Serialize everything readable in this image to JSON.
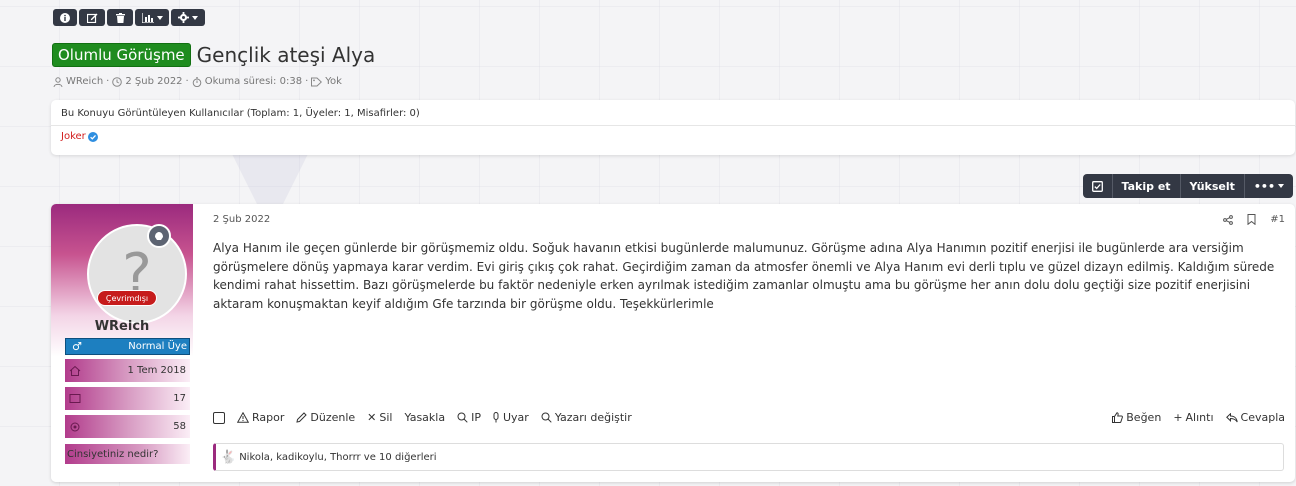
{
  "toolbar": {
    "icons": [
      "info-icon",
      "edit-icon",
      "trash-icon",
      "chart-icon",
      "gear-icon"
    ]
  },
  "thread": {
    "prefix": "Olumlu Görüşme",
    "title": "Gençlik ateşi Alya",
    "meta": {
      "author": "WReich",
      "date": "2 Şub 2022",
      "read_time": "Okuma süresi: 0:38",
      "tags": "Yok"
    }
  },
  "viewers": {
    "title": "Bu Konuyu Görüntüleyen Kullanıcılar (Toplam: 1, Üyeler: 1, Misafirler: 0)",
    "users": [
      "Joker"
    ]
  },
  "actions": {
    "follow": "Takip et",
    "bump": "Yükselt",
    "more": "•••"
  },
  "post": {
    "user": {
      "avatar_letter": "?",
      "status": "Çevrimdışı",
      "name": "WReich",
      "gender_symbol": "♂",
      "role": "Normal Üye",
      "joined": "1 Tem 2018",
      "messages": "17",
      "points": "58",
      "question": "Cinsiyetiniz nedir?"
    },
    "date": "2 Şub 2022",
    "number": "#1",
    "body": "Alya Hanım ile geçen günlerde bir görüşmemiz oldu. Soğuk havanın etkisi bugünlerde malumunuz. Görüşme adına Alya Hanımın pozitif enerjisi ile bugünlerde ara versiğim görüşmelere dönüş yapmaya karar verdim. Evi giriş çıkış çok rahat. Geçirdiğim zaman da atmosfer önemli ve Alya Hanım evi derli tıplu ve güzel dizayn edilmiş. Kaldığım sürede kendimi rahat hissettim. Bazı görüşmelerde bu faktör nedeniyle erken ayrılmak istediğim zamanlar olmuştu ama bu görüşme her anın dolu dolu geçtiği size pozitif enerjisini aktaram konuşmaktan keyif aldığım Gfe tarzında bir görüşme oldu. Teşekkürlerimle",
    "footer_left": {
      "report": "Rapor",
      "edit": "Düzenle",
      "delete": "Sil",
      "ban": "Yasakla",
      "ip": "IP",
      "warn": "Uyar",
      "change_author": "Yazarı değiştir"
    },
    "footer_right": {
      "like": "Beğen",
      "quote": "Alıntı",
      "reply": "Cevapla"
    },
    "reactions": "Nikola, kadikoylu, Thorrr ve 10 diğerleri"
  },
  "colors": {
    "prefix_green": "#1f8c1f",
    "dark": "#333844",
    "accent": "#9b2a7e",
    "role_blue": "#1d7fc0",
    "offline_red": "#c61c1c"
  }
}
